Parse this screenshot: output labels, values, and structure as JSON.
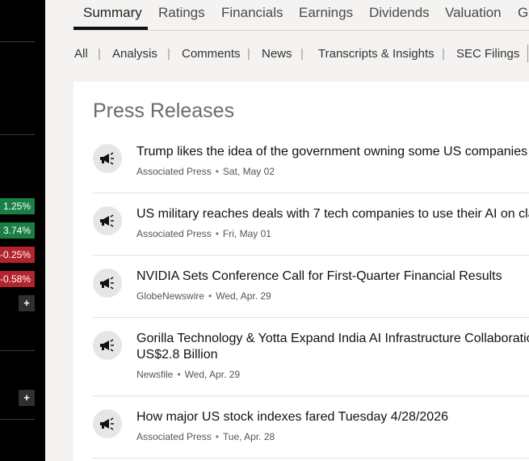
{
  "sidebar": {
    "changes": [
      "1.25%",
      "3.74%",
      "-0.25%",
      "-0.58%"
    ],
    "add_label": "+"
  },
  "tabs": [
    "Summary",
    "Ratings",
    "Financials",
    "Earnings",
    "Dividends",
    "Valuation",
    "Gr"
  ],
  "subnav": {
    "items": [
      "All",
      "Analysis",
      "Comments",
      "News",
      "Transcripts & Insights",
      "SEC Filings"
    ],
    "separator": "|"
  },
  "press_releases": {
    "title": "Press Releases",
    "items": [
      {
        "title": "Trump likes the idea of the government owning some US companies",
        "source": "Associated Press",
        "date": "Sat, May 02"
      },
      {
        "title": "US military reaches deals with 7 tech companies to use their AI on cla",
        "source": "Associated Press",
        "date": "Fri, May 01"
      },
      {
        "title": "NVIDIA Sets Conference Call for First-Quarter Financial Results",
        "source": "GlobeNewswire",
        "date": "Wed, Apr. 29"
      },
      {
        "title": "Gorilla Technology & Yotta Expand India AI Infrastructure Collaboratio",
        "title2": "US$2.8 Billion",
        "source": "Newsfile",
        "date": "Wed, Apr. 29"
      },
      {
        "title": "How major US stock indexes fared Tuesday 4/28/2026",
        "source": "Associated Press",
        "date": "Tue, Apr. 28"
      }
    ]
  },
  "colors": {
    "up": "#1a7f45",
    "down": "#b3232e",
    "sidebar": "#000000"
  },
  "icons": {
    "press_release": "megaphone-icon"
  }
}
